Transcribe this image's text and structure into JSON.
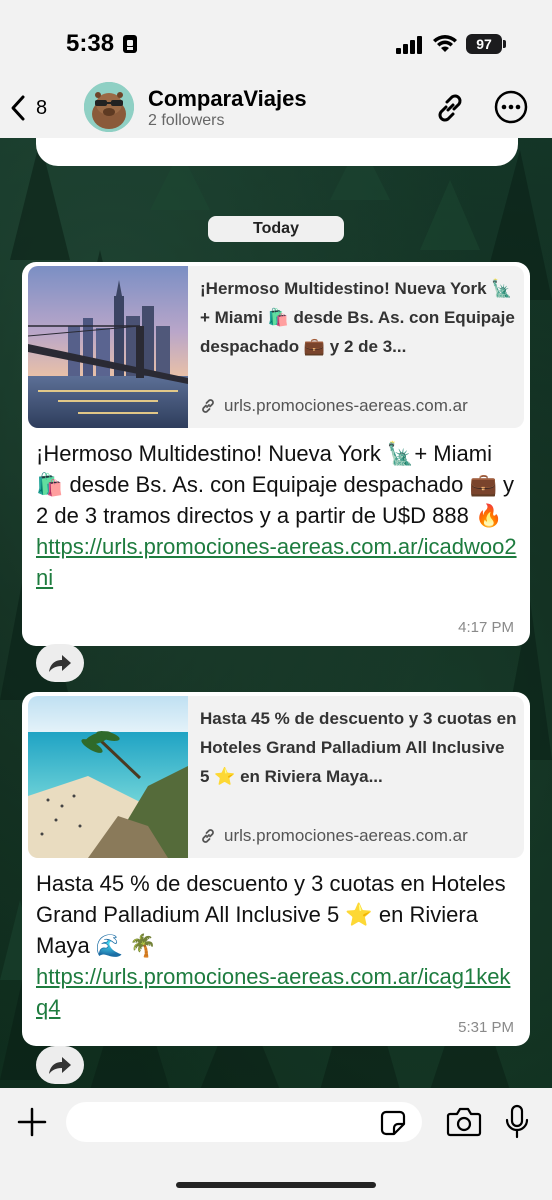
{
  "status_bar": {
    "time": "5:38",
    "battery": "97"
  },
  "header": {
    "back_count": "8",
    "channel_name": "ComparaViajes",
    "followers": "2 followers"
  },
  "chat": {
    "date_label": "Today",
    "messages": [
      {
        "preview_title": "¡Hermoso Multidestino! Nueva York 🗽+ Miami 🛍️ desde Bs. As. con Equipaje despachado 💼 y 2 de 3...",
        "preview_url": "urls.promociones-aereas.com.ar",
        "body": "¡Hermoso Multidestino! Nueva York 🗽+ Miami 🛍️ desde Bs. As. con Equipaje despachado 💼 y 2 de 3 tramos directos y a partir de U$D 888 🔥",
        "link": "https://urls.promociones-aereas.com.ar/icadwoo2ni",
        "time": "4:17 PM"
      },
      {
        "preview_title": "Hasta 45 % de descuento y 3 cuotas en Hoteles Grand Palladium All Inclusive 5 ⭐ en Riviera Maya...",
        "preview_url": "urls.promociones-aereas.com.ar",
        "body": "Hasta 45 % de descuento y 3 cuotas en Hoteles Grand Palladium All Inclusive 5 ⭐ en Riviera Maya 🌊 🌴",
        "link": "https://urls.promociones-aereas.com.ar/icag1kekq4",
        "time": "5:31 PM"
      }
    ]
  },
  "composer": {
    "input_value": "",
    "placeholder": ""
  },
  "icons": {
    "back": "chevron-left-icon",
    "link": "link-icon",
    "more": "more-icon",
    "share": "share-icon",
    "plus": "plus-icon",
    "sticker": "sticker-icon",
    "camera": "camera-icon",
    "mic": "microphone-icon"
  },
  "colors": {
    "link": "#1e7c3f",
    "header_bg": "#f2f2f2",
    "bubble_bg": "#ffffff"
  }
}
